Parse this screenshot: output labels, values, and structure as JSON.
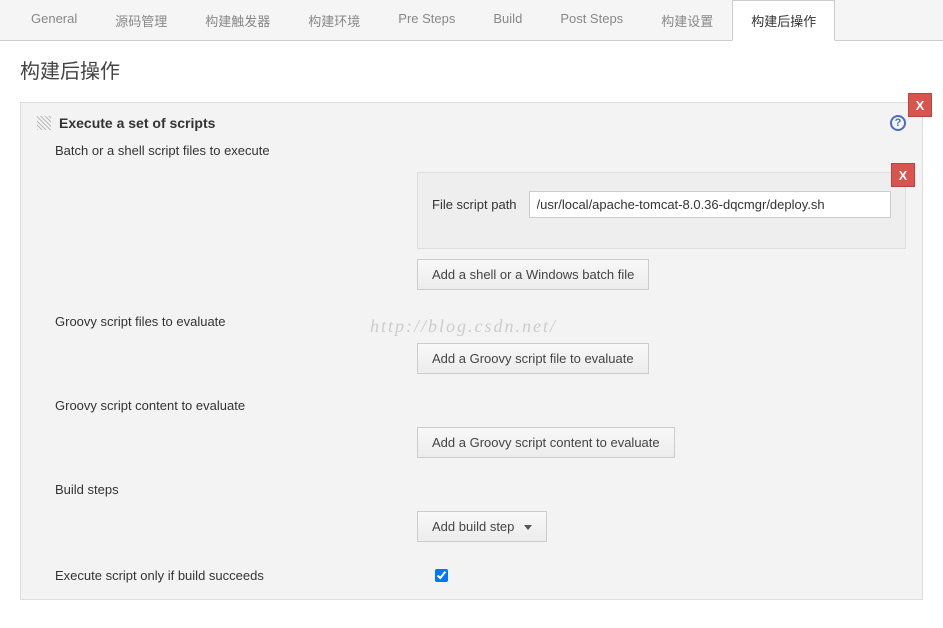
{
  "tabs": [
    {
      "label": "General",
      "active": false
    },
    {
      "label": "源码管理",
      "active": false
    },
    {
      "label": "构建触发器",
      "active": false
    },
    {
      "label": "构建环境",
      "active": false
    },
    {
      "label": "Pre Steps",
      "active": false
    },
    {
      "label": "Build",
      "active": false
    },
    {
      "label": "Post Steps",
      "active": false
    },
    {
      "label": "构建设置",
      "active": false
    },
    {
      "label": "构建后操作",
      "active": true
    }
  ],
  "page_title": "构建后操作",
  "block": {
    "title": "Execute a set of scripts",
    "help_glyph": "?",
    "close_glyph": "X",
    "sections": {
      "batch": {
        "label": "Batch or a shell script files to execute",
        "file_path_label": "File script path",
        "file_path_value": "/usr/local/apache-tomcat-8.0.36-dqcmgr/deploy.sh",
        "add_button": "Add a shell or a Windows batch file"
      },
      "groovy_file": {
        "label": "Groovy script files to evaluate",
        "add_button": "Add a Groovy script file to evaluate"
      },
      "groovy_content": {
        "label": "Groovy script content to evaluate",
        "add_button": "Add a Groovy script content to evaluate"
      },
      "build_steps": {
        "label": "Build steps",
        "add_button": "Add build step"
      },
      "execute_only_success": {
        "label": "Execute script only if build succeeds",
        "checked": true
      }
    }
  },
  "watermark": "http://blog.csdn.net/"
}
